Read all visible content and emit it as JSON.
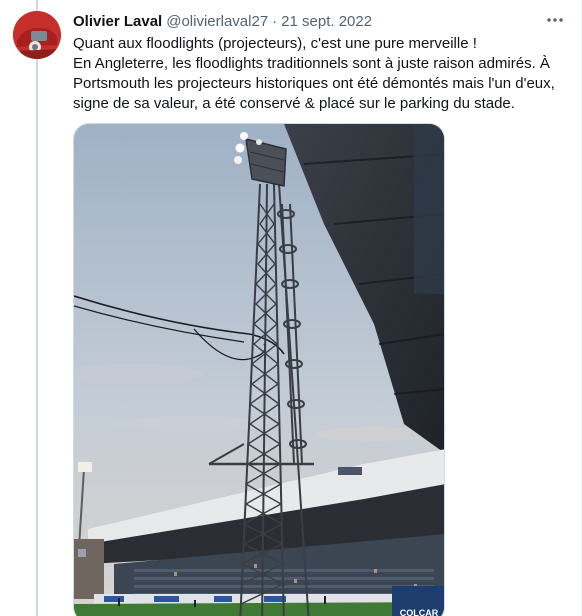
{
  "tweet": {
    "author_name": "Olivier Laval",
    "handle": "@olivierlaval27",
    "separator": "·",
    "date": "21 sept. 2022",
    "more_label": "•••",
    "text_lines": [
      "Quant aux floodlights (projecteurs), c'est une pure merveille !",
      "En Angleterre, les floodlights traditionnels sont à juste raison admirés. À Portsmouth les projecteurs historiques ont été démontés mais l'un d'eux, signe de sa valeur, a été conservé & placé sur le parking du stade."
    ],
    "media": {
      "sign_text": "COLCAR"
    }
  },
  "colors": {
    "avatar_bg": "#c9302c",
    "thread_line": "#cfd9de",
    "secondary_text": "#536471",
    "sky_top": "#a9b9cc",
    "sky_bottom": "#cfd6de",
    "stand_roof": "#2c3138",
    "pitch": "#3f7a34"
  },
  "icons": {
    "more": "more-horizontal-icon"
  }
}
